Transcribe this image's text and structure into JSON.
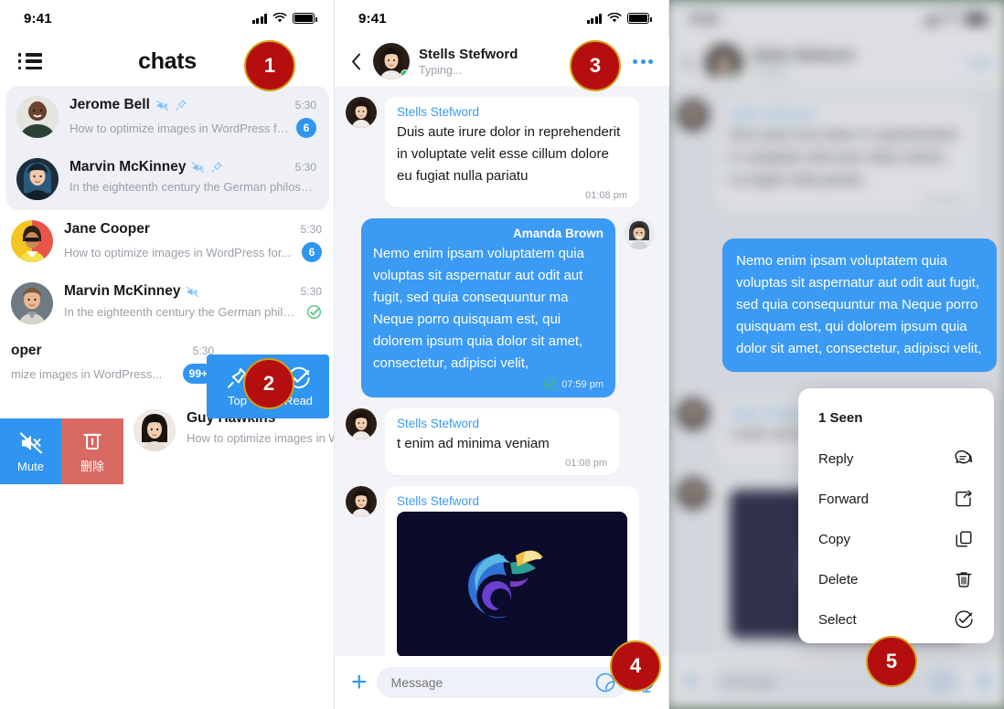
{
  "meta": {
    "accent_blue": "#2f95f0",
    "bubble_blue": "#3b9af4",
    "delete_red": "#d96a63",
    "callout_red": "#b50e0e",
    "callout_ring": "#d4a017",
    "chat_bg": "#f2f4f8",
    "panel_frame_green": "#4a6b48"
  },
  "status_bar": {
    "time": "9:41"
  },
  "list_panel": {
    "header": {
      "menu_icon": "list-menu-icon",
      "title": "chats"
    },
    "chats": [
      {
        "name": "Jerome Bell",
        "preview": "How to optimize images in WordPress for...",
        "time": "5:30",
        "badge": "6",
        "muted": true,
        "pinned": true,
        "highlighted": true
      },
      {
        "name": "Marvin McKinney",
        "preview": "In the eighteenth century the German philosoph...",
        "time": "5:30",
        "badge": "",
        "muted": true,
        "pinned": true,
        "highlighted": true
      },
      {
        "name": "Jane Cooper",
        "preview": "How to optimize images in WordPress for...",
        "time": "5:30",
        "badge": "6",
        "muted": false,
        "pinned": false,
        "highlighted": false
      },
      {
        "name": "Marvin McKinney",
        "preview": "In the eighteenth century the German philos...",
        "time": "5:30",
        "badge": "",
        "read_check": true,
        "muted": true,
        "pinned": false,
        "highlighted": false
      }
    ],
    "partial_row": {
      "name": "oper",
      "preview": "mize images in WordPress...",
      "time": "5:30",
      "badge": "99+"
    },
    "swipe_actions_top": [
      {
        "label": "Top",
        "icon": "pin-icon"
      },
      {
        "label": "Read",
        "icon": "check-circle-icon"
      }
    ],
    "swipe_actions_bottom": [
      {
        "label": "Mute",
        "icon": "mute-icon"
      },
      {
        "label": "删除",
        "icon": "trash-icon"
      }
    ],
    "last_row": {
      "name": "Guy Hawkins",
      "preview": "How to optimize images in W"
    }
  },
  "chat_panel": {
    "header": {
      "back_icon": "chevron-left-icon",
      "name": "Stells Stefword",
      "status": "Typing...",
      "more_icon": "more-dots-icon",
      "online": true
    },
    "messages": [
      {
        "side": "in",
        "sender": "Stells Stefword",
        "text": "Duis aute irure dolor in reprehenderit in voluptate velit esse cillum dolore eu fugiat nulla pariatu",
        "time": "01:08 pm"
      },
      {
        "side": "out",
        "sender": "Amanda Brown",
        "text": "Nemo enim ipsam voluptatem quia voluptas sit aspernatur aut odit aut fugit, sed quia consequuntur ma Neque porro quisquam est, qui dolorem ipsum quia dolor sit amet, consectetur, adipisci velit,",
        "time": "07:59 pm",
        "delivered": true
      },
      {
        "side": "in",
        "sender": "Stells Stefword",
        "text": "t enim ad minima veniam",
        "time": "01:08 pm"
      },
      {
        "side": "in",
        "sender": "Stells Stefword",
        "image": "chameleon-logo-image"
      }
    ],
    "composer": {
      "add_icon": "plus-icon",
      "placeholder": "Message",
      "sticker_icon": "sticker-icon",
      "mic_icon": "microphone-icon"
    }
  },
  "menu_panel": {
    "blurred_chat": {
      "name": "Stells Stefword",
      "status": "Typing...",
      "highlighted_message": "Nemo enim ipsam voluptatem quia voluptas sit aspernatur aut odit aut fugit, sed quia consequuntur ma Neque porro quisquam est, qui dolorem ipsum quia dolor sit amet, consectetur, adipisci velit,"
    },
    "context_menu": {
      "seen_label": "1 Seen",
      "items": [
        {
          "label": "Reply",
          "icon": "reply-icon"
        },
        {
          "label": "Forward",
          "icon": "forward-icon"
        },
        {
          "label": "Copy",
          "icon": "copy-icon"
        },
        {
          "label": "Delete",
          "icon": "trash-icon"
        },
        {
          "label": "Select",
          "icon": "check-circle-icon"
        }
      ]
    }
  },
  "callouts": [
    {
      "number": "1"
    },
    {
      "number": "2"
    },
    {
      "number": "3"
    },
    {
      "number": "4"
    },
    {
      "number": "5"
    }
  ]
}
